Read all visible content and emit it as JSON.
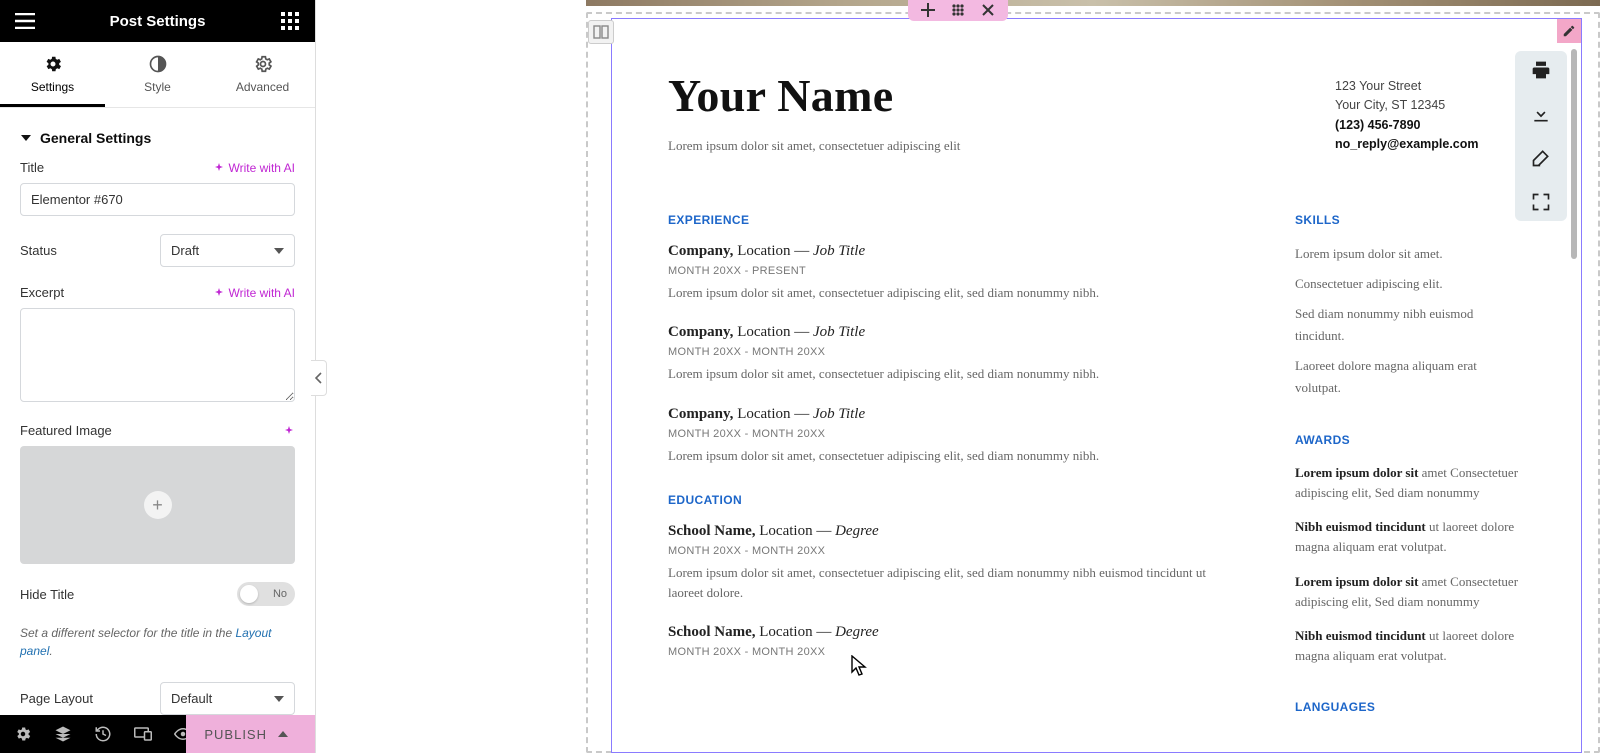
{
  "panel": {
    "title": "Post Settings",
    "tabs": {
      "settings": "Settings",
      "style": "Style",
      "advanced": "Advanced"
    },
    "section_general": "General Settings",
    "labels": {
      "title": "Title",
      "status": "Status",
      "excerpt": "Excerpt",
      "featured_image": "Featured Image",
      "hide_title": "Hide Title",
      "page_layout": "Page Layout"
    },
    "ai": "Write with AI",
    "title_value": "Elementor #670",
    "status_value": "Draft",
    "excerpt_value": "",
    "hide_title_value": "No",
    "page_layout_value": "Default",
    "hint_prefix": "Set a different selector for the title in the ",
    "hint_link": "Layout panel",
    "hint_suffix": ".",
    "publish": "PUBLISH"
  },
  "doc": {
    "name": "Your Name",
    "tagline": "Lorem ipsum dolor sit amet, consectetuer adipiscing elit",
    "contact": {
      "street": "123 Your Street",
      "city": "Your City, ST 12345",
      "phone": "(123) 456-7890",
      "email": "no_reply@example.com"
    },
    "sections": {
      "experience": "EXPERIENCE",
      "education": "EDUCATION",
      "skills": "SKILLS",
      "awards": "AWARDS",
      "languages": "LANGUAGES"
    },
    "experience": [
      {
        "company": "Company,",
        "loc": "Location",
        "dash": " — ",
        "title": "Job Title",
        "date": "MONTH 20XX - PRESENT",
        "desc": "Lorem ipsum dolor sit amet, consectetuer adipiscing elit, sed diam nonummy nibh."
      },
      {
        "company": "Company,",
        "loc": "Location",
        "dash": " — ",
        "title": "Job Title",
        "date": "MONTH 20XX - MONTH 20XX",
        "desc": "Lorem ipsum dolor sit amet, consectetuer adipiscing elit, sed diam nonummy nibh."
      },
      {
        "company": "Company,",
        "loc": "Location",
        "dash": " — ",
        "title": "Job Title",
        "date": "MONTH 20XX - MONTH 20XX",
        "desc": "Lorem ipsum dolor sit amet, consectetuer adipiscing elit, sed diam nonummy nibh."
      }
    ],
    "education": [
      {
        "school": "School Name,",
        "loc": "Location",
        "dash": " — ",
        "degree": "Degree",
        "date": "MONTH 20XX - MONTH 20XX",
        "desc": "Lorem ipsum dolor sit amet, consectetuer adipiscing elit, sed diam nonummy nibh euismod tincidunt ut laoreet dolore."
      },
      {
        "school": "School Name,",
        "loc": "Location",
        "dash": " — ",
        "degree": "Degree",
        "date": "MONTH 20XX - MONTH 20XX",
        "desc": ""
      }
    ],
    "skills": [
      "Lorem ipsum dolor sit amet.",
      "Consectetuer adipiscing elit.",
      "Sed diam nonummy nibh euismod tincidunt.",
      "Laoreet dolore magna aliquam erat volutpat."
    ],
    "awards": [
      {
        "lead": "Lorem ipsum dolor sit",
        "rest": " amet Consectetuer adipiscing elit, Sed diam nonummy"
      },
      {
        "lead": "Nibh euismod tincidunt",
        "rest": " ut laoreet dolore magna aliquam erat volutpat."
      },
      {
        "lead": "Lorem ipsum dolor sit",
        "rest": " amet Consectetuer adipiscing elit, Sed diam nonummy"
      },
      {
        "lead": "Nibh euismod tincidunt",
        "rest": " ut laoreet dolore magna aliquam erat volutpat."
      }
    ]
  }
}
